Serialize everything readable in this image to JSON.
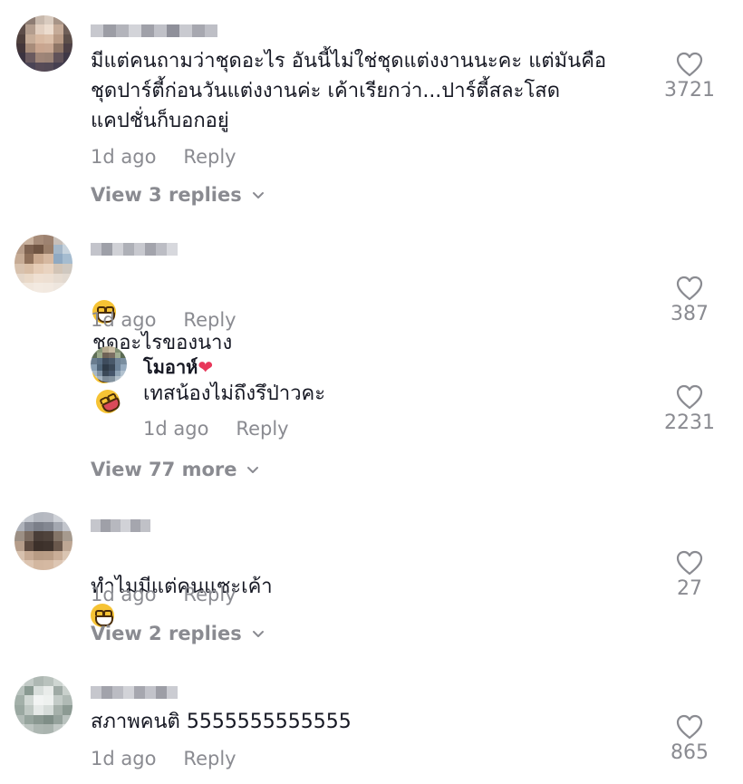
{
  "comments": [
    {
      "username_display": "mad_passinna",
      "text": "มีแต่คนถามว่าชุดอะไร อันนี้ไม่ใช่ชุดแต่งงานนะคะ แต่มันคือ\nชุดปาร์ตี้ก่อนวันแต่งงานค่ะ เค้าเรียกว่า...ปาร์ตี้สละโสด\nแคปชั่นก็บอกอยู่",
      "time": "1d ago",
      "reply_label": "Reply",
      "likes": "3721",
      "view_replies": "View 3 replies"
    },
    {
      "username_display": "user",
      "text_before": "ชุดอะไรของนาง",
      "time": "1d ago",
      "reply_label": "Reply",
      "likes": "387",
      "reply": {
        "username": "โมอาห์",
        "text": "เทสน้องไม่ถึงรึป่าวคะ",
        "time": "1d ago",
        "reply_label": "Reply",
        "likes": "2231"
      },
      "view_more": "View 77 more"
    },
    {
      "username_display": "user",
      "text": "ทำไมมีแต่คนแซะเค้า",
      "time": "1d ago",
      "reply_label": "Reply",
      "likes": "27",
      "view_replies": "View 2 replies"
    },
    {
      "username_display": "user",
      "text": "สภาพคนติ 5555555555555",
      "time": "1d ago",
      "reply_label": "Reply",
      "likes": "865"
    }
  ],
  "icons": {
    "like": "heart-outline-icon",
    "chevron": "chevron-down-icon"
  },
  "colors": {
    "text": "#161823",
    "muted": "#8a8b91",
    "reply_heart": "#e8375a"
  }
}
